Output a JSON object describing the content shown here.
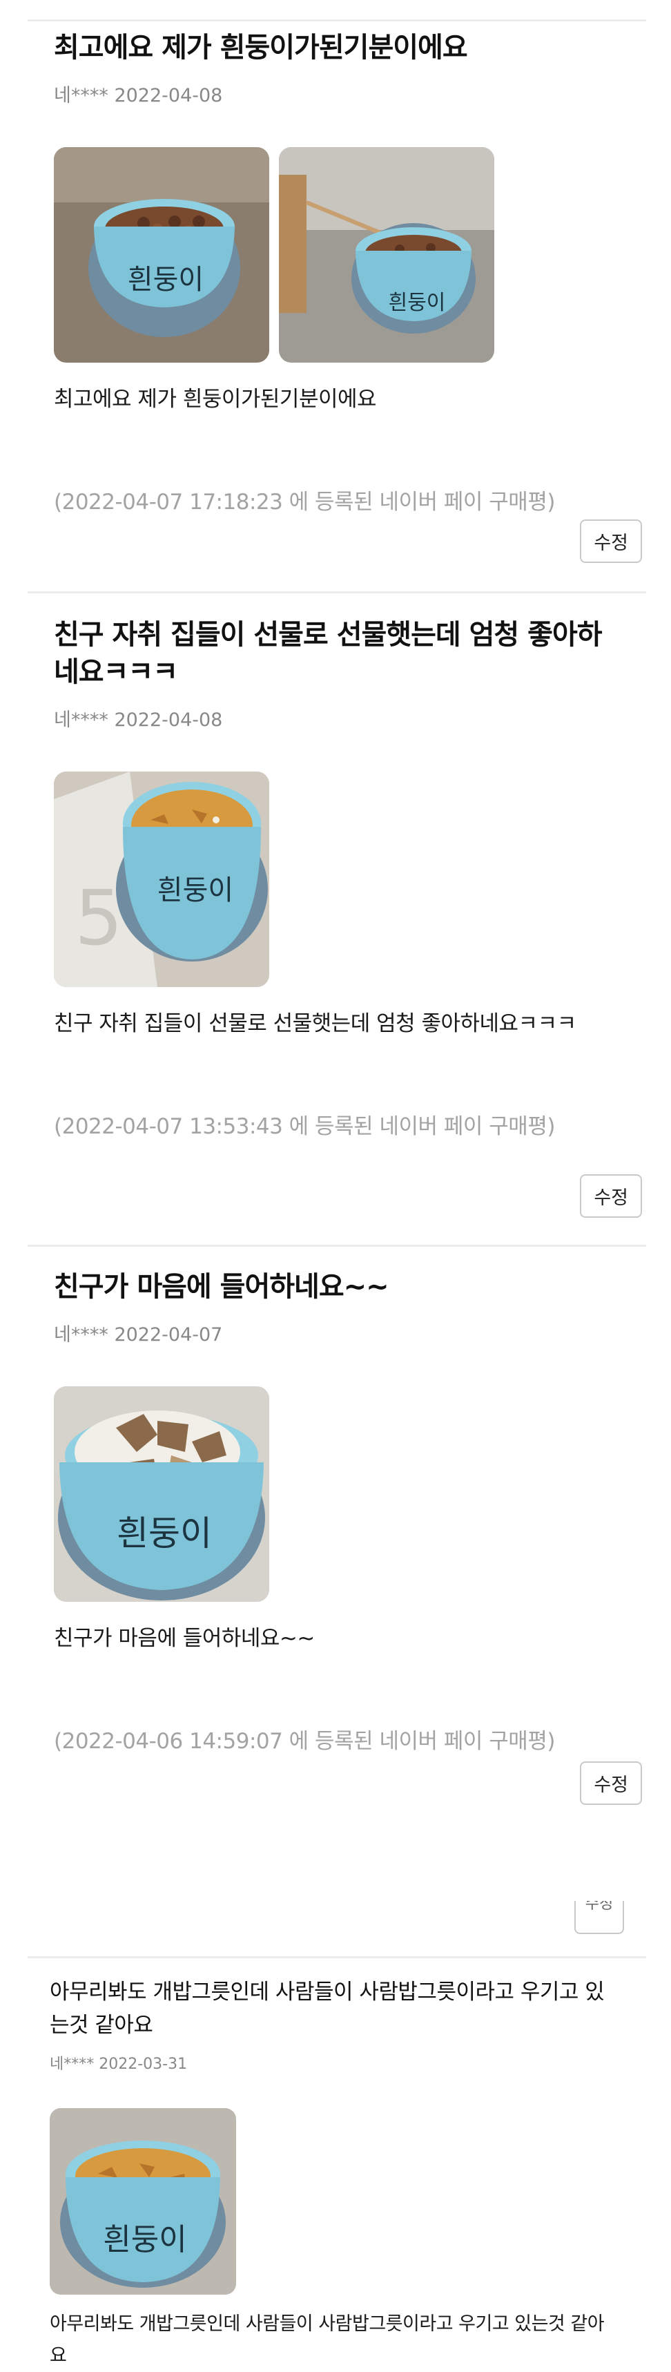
{
  "reviews": [
    {
      "title": "최고에요 제가 흰둥이가된기분이에요",
      "author": "네****",
      "date": "2022-04-08",
      "photos": [
        {
          "bowl_text": "흰둥이",
          "food": "kibble"
        },
        {
          "bowl_text": "흰둥이",
          "food": "kibble-spoon"
        }
      ],
      "body": "최고에요 제가 흰둥이가된기분이에요",
      "purchase": "(2022-04-07 17:18:23 에 등록된 네이버 페이 구매평)",
      "edit_label": "수정"
    },
    {
      "title": "친구 자취 집들이 선물로 선물햇는데 엄청 좋아하네요ㅋㅋㅋ",
      "author": "네****",
      "date": "2022-04-08",
      "photos": [
        {
          "bowl_text": "흰둥이",
          "food": "cereal"
        }
      ],
      "body": "친구 자취 집들이 선물로 선물햇는데 엄청 좋아하네요ㅋㅋㅋ",
      "purchase": "(2022-04-07 13:53:43 에 등록된 네이버 페이 구매평)",
      "edit_label": "수정"
    },
    {
      "title": "친구가 마음에 들어하네요~~",
      "author": "네****",
      "date": "2022-04-07",
      "photos": [
        {
          "bowl_text": "흰둥이",
          "food": "rice-meat"
        }
      ],
      "body": "친구가 마음에 들어하네요~~",
      "purchase": "(2022-04-06 14:59:07 에 등록된 네이버 페이 구매평)",
      "edit_label": "수정"
    },
    {
      "title": "아무리봐도 개밥그릇인데 사람들이 사람밥그릇이라고 우기고 있는것 같아요",
      "author": "네****",
      "date": "2022-03-31",
      "photos": [
        {
          "bowl_text": "흰둥이",
          "food": "cereal"
        }
      ],
      "body": "아무리봐도 개밥그릇인데 사람들이 사람밥그릇이라고 우기고 있는것 같아요"
    }
  ],
  "cut_button_label": "수정",
  "colors": {
    "bowl": "#7fc3d8",
    "divider": "#ececec",
    "meta": "#888888",
    "purchase": "#a3a3a3"
  }
}
